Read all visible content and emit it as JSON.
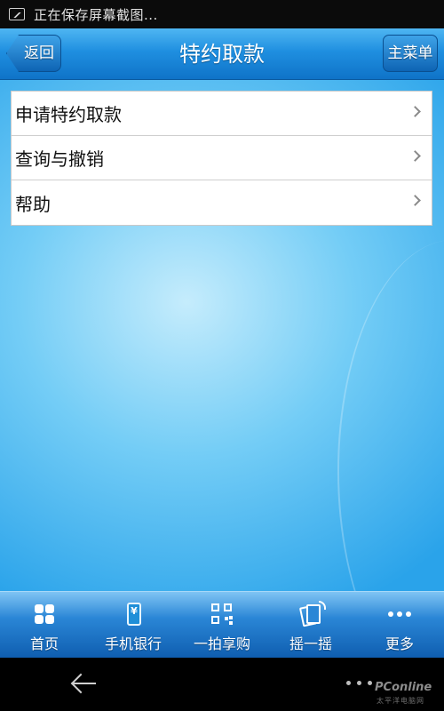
{
  "status_bar": {
    "text": "正在保存屏幕截图..."
  },
  "header": {
    "title": "特约取款",
    "back_label": "返回",
    "menu_label": "主菜单"
  },
  "menu": {
    "items": [
      {
        "label": "申请特约取款"
      },
      {
        "label": "查询与撤销"
      },
      {
        "label": "帮助"
      }
    ]
  },
  "tabs": [
    {
      "label": "首页",
      "icon": "grid-icon"
    },
    {
      "label": "手机银行",
      "icon": "mobile-banking-icon"
    },
    {
      "label": "一拍享购",
      "icon": "qr-code-icon"
    },
    {
      "label": "摇一摇",
      "icon": "shake-icon"
    },
    {
      "label": "更多",
      "icon": "more-dots-icon"
    }
  ],
  "watermark": {
    "brand": "PConline",
    "sub": "太平洋电脑网"
  },
  "colors": {
    "accent": "#1f8fe0",
    "background": "#74cdf6"
  }
}
